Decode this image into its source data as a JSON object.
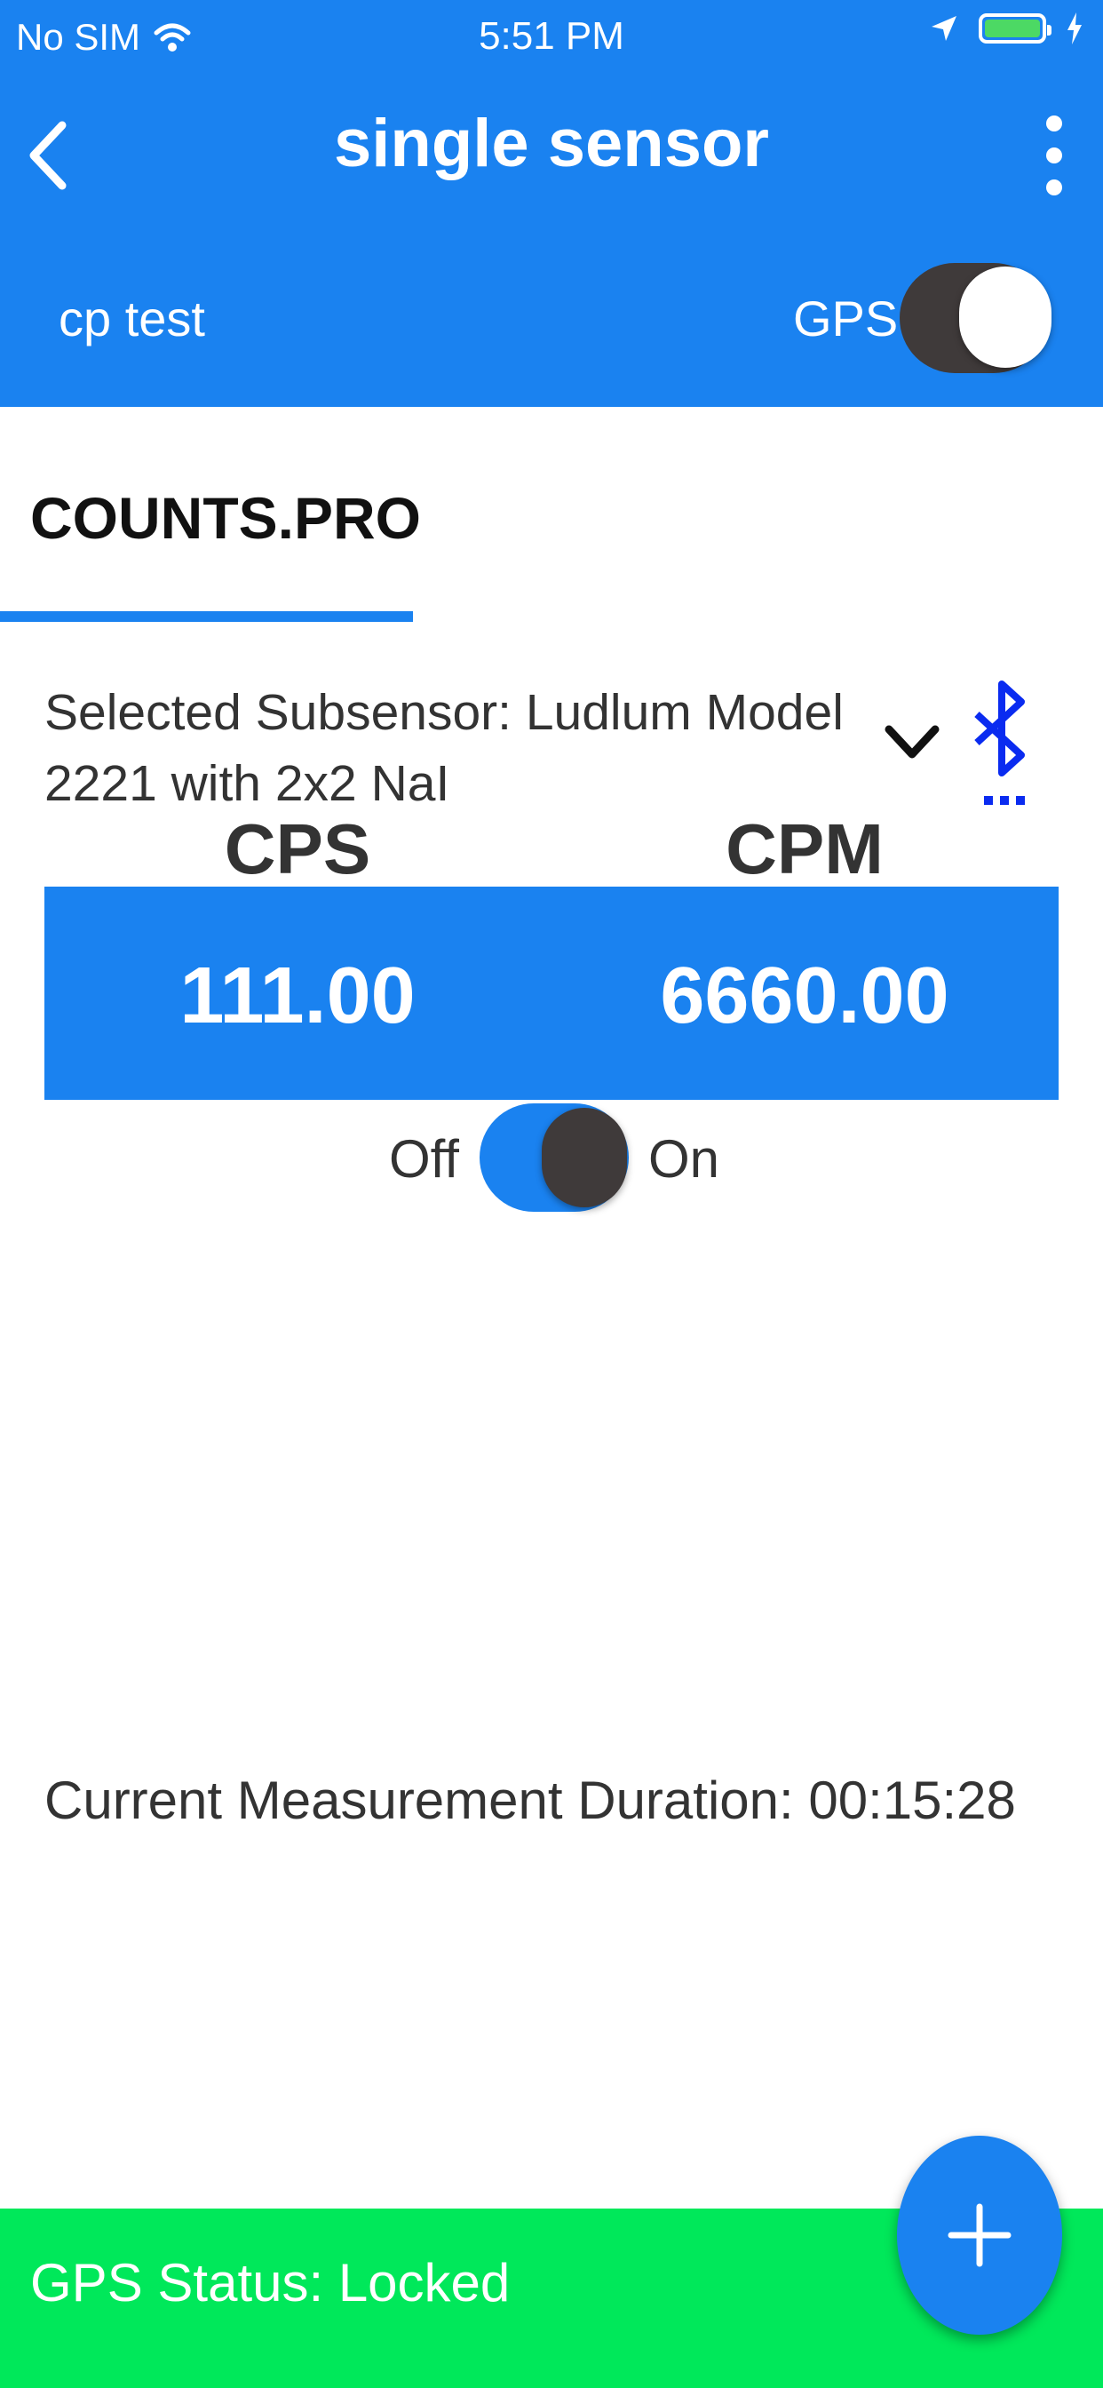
{
  "status_bar": {
    "carrier": "No SIM",
    "time": "5:51 PM",
    "battery_color": "#4cd964"
  },
  "header": {
    "title": "single sensor",
    "back_icon": "chevron-left-icon",
    "menu_icon": "more-vertical-icon",
    "project_name": "cp test",
    "gps_label": "GPS",
    "gps_enabled": true
  },
  "tabs": [
    {
      "label": "COUNTS.PRO",
      "active": true
    }
  ],
  "subsensor": {
    "label": "Selected Subsensor: Ludlum Model 2221 with 2x2 NaI",
    "dropdown_icon": "chevron-down-icon",
    "connection_icon": "bluetooth-icon"
  },
  "readings": {
    "cps_label": "CPS",
    "cpm_label": "CPM",
    "cps_value": "111.00",
    "cpm_value": "6660.00"
  },
  "measurement_toggle": {
    "off_label": "Off",
    "on_label": "On",
    "state": "on"
  },
  "duration_text": "Current Measurement Duration: 00:15:28",
  "footer": {
    "gps_status": "GPS Status: Locked",
    "fab_icon": "plus-icon"
  },
  "colors": {
    "accent": "#1a82f0",
    "status_ok": "#00e85a",
    "toggle_dark": "#3f3a3a",
    "bluetooth": "#0a2bf0"
  }
}
